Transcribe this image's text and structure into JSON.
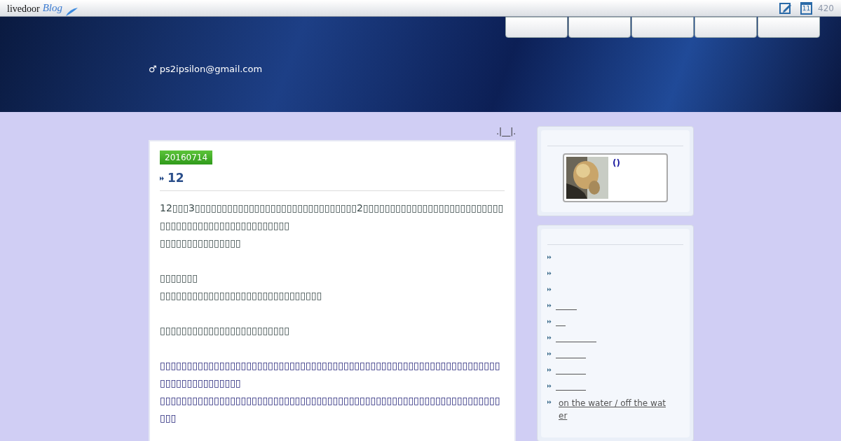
{
  "topbar": {
    "logo": "livedoor",
    "logo_suffix": "Blog",
    "calendar_day": "11",
    "counter": "420"
  },
  "header": {
    "nav_tabs": [
      {
        "kind": "tab"
      },
      {
        "kind": "tab"
      },
      {
        "kind": "tab"
      },
      {
        "kind": "tab"
      },
      {
        "kind": "tab"
      }
    ],
    "owner": "♂ ps2ipsilon@gmail.com"
  },
  "breadcrumb": ".|__|.",
  "post": {
    "date": "20160714",
    "title": "12",
    "paragraphs": [
      {
        "kind": "plain",
        "text": "12▯▯▯3▯▯▯▯▯▯▯▯▯▯▯▯▯▯▯▯▯▯▯▯▯▯▯▯▯▯▯▯▯▯2▯▯▯▯▯▯▯▯▯▯▯▯▯▯▯▯▯▯▯▯▯▯▯▯▯▯▯▯▯▯▯▯▯▯▯▯▯▯▯▯▯▯▯▯▯▯▯▯▯▯\n▯▯▯▯▯▯▯▯▯▯▯▯▯▯▯"
      },
      {
        "kind": "plain",
        "text": "▯▯▯▯▯▯▯\n▯▯▯▯▯▯▯▯▯▯▯▯▯▯▯▯▯▯▯▯▯▯▯▯▯▯▯▯▯▯"
      },
      {
        "kind": "plain",
        "text": "▯▯▯▯▯▯▯▯▯▯▯▯▯▯▯▯▯▯▯▯▯▯▯▯"
      },
      {
        "kind": "link",
        "text": "▯▯▯▯▯▯▯▯▯▯▯▯▯▯▯▯▯▯▯▯▯▯▯▯▯▯▯▯▯▯▯▯▯▯▯▯▯▯▯▯▯▯▯▯▯▯▯▯▯▯▯▯▯▯▯▯▯▯▯▯▯▯▯▯▯▯▯▯▯▯▯▯▯▯▯▯▯▯\n▯▯▯▯▯▯▯▯▯▯▯▯▯▯▯▯▯▯▯▯▯▯▯▯▯▯▯▯▯▯▯▯▯▯▯▯▯▯▯▯▯▯▯▯▯▯▯▯▯▯▯▯▯▯▯▯▯▯▯▯▯▯▯▯▯▯"
      }
    ]
  },
  "profile": {
    "name": "()"
  },
  "links": [
    {
      "kind": "blank"
    },
    {
      "kind": "blank"
    },
    {
      "kind": "blank"
    },
    {
      "kind": "underline"
    },
    {
      "kind": "underline"
    },
    {
      "kind": "underline"
    },
    {
      "kind": "underline"
    },
    {
      "kind": "underline"
    },
    {
      "kind": "underline"
    },
    {
      "kind": "text",
      "label": "on the water / off the water"
    }
  ]
}
